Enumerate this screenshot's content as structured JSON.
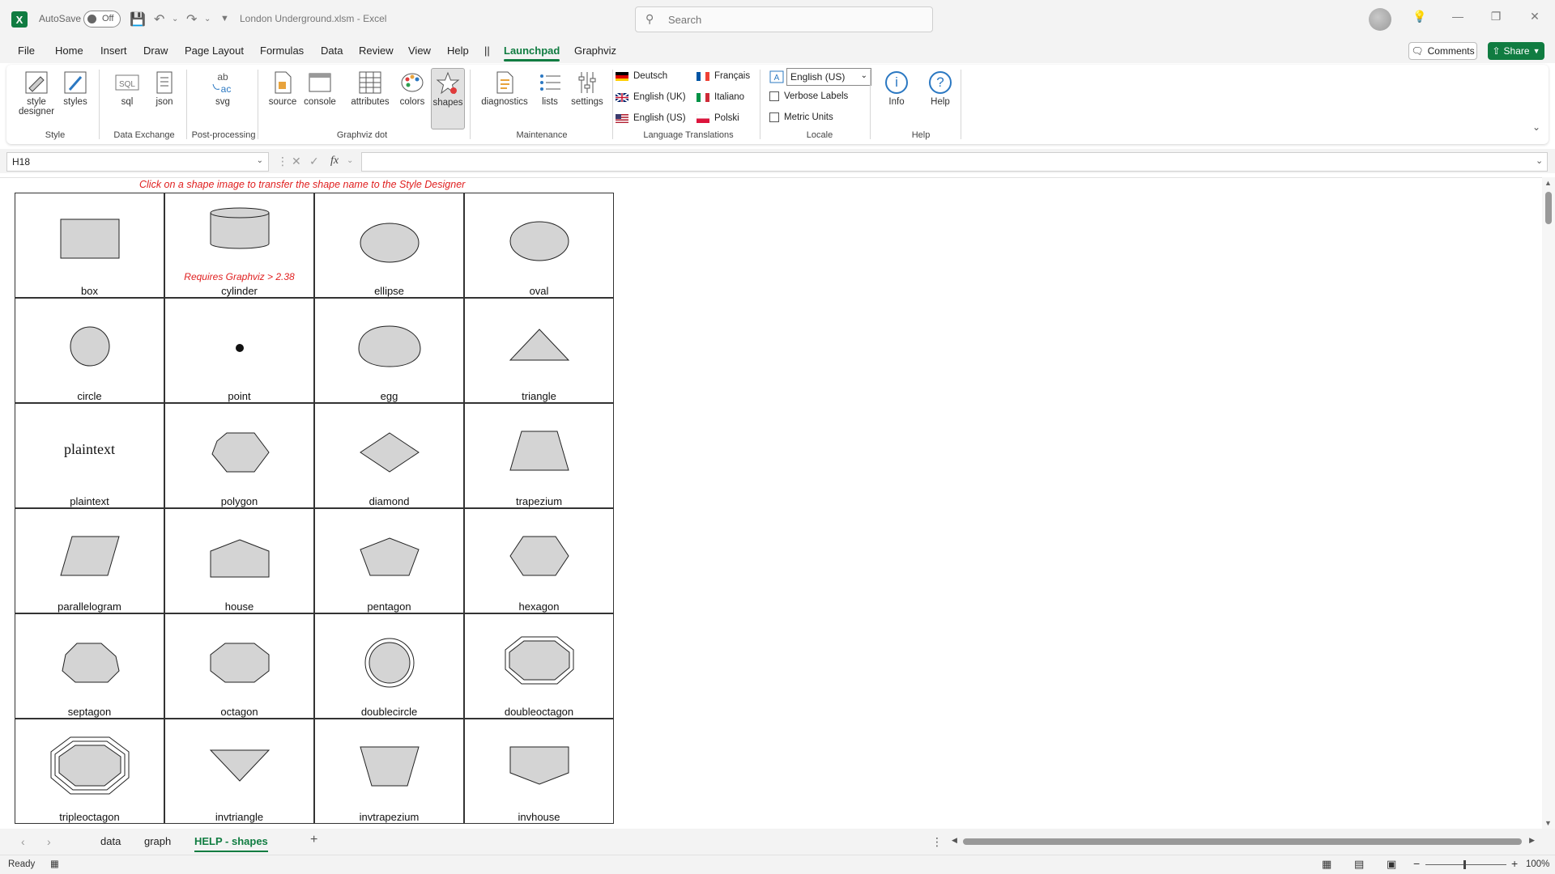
{
  "title_bar": {
    "app_icon": "excel-logo-icon",
    "autosave_label": "AutoSave",
    "autosave_state": "Off",
    "document_title": "London Underground.xlsm  -  Excel",
    "search_placeholder": "Search"
  },
  "menu": {
    "tabs": [
      "File",
      "Home",
      "Insert",
      "Draw",
      "Page Layout",
      "Formulas",
      "Data",
      "Review",
      "View",
      "Help",
      "||",
      "Launchpad",
      "Graphviz"
    ],
    "active_tab": "Launchpad",
    "comments_label": "Comments",
    "share_label": "Share"
  },
  "ribbon": {
    "groups": {
      "style": "Style",
      "data_exchange": "Data Exchange",
      "post_processing": "Post-processing",
      "graphviz_dot": "Graphviz dot",
      "maintenance": "Maintenance",
      "language_translations": "Language Translations",
      "locale": "Locale",
      "help": "Help"
    },
    "buttons": {
      "style_designer_1": "style",
      "style_designer_2": "designer",
      "styles": "styles",
      "sql": "sql",
      "json": "json",
      "svg": "svg",
      "source": "source",
      "console": "console",
      "attributes": "attributes",
      "colors": "colors",
      "shapes": "shapes",
      "diagnostics": "diagnostics",
      "lists": "lists",
      "settings": "settings",
      "info": "Info",
      "help": "Help"
    },
    "languages": {
      "deutsch": "Deutsch",
      "francais": "Français",
      "english_uk": "English (UK)",
      "italiano": "Italiano",
      "english_us": "English (US)",
      "polski": "Polski"
    },
    "locale": {
      "selected": "English (US)",
      "verbose_labels": "Verbose Labels",
      "metric_units": "Metric Units"
    }
  },
  "formula_bar": {
    "name_box": "H18",
    "fx_label": "fx",
    "formula": ""
  },
  "sheet": {
    "instruction": "Click on a shape image to transfer the shape name to the Style Designer",
    "cylinder_note": "Requires Graphviz > 2.38",
    "plaintext_sample": "plaintext",
    "shapes": [
      "box",
      "cylinder",
      "ellipse",
      "oval",
      "circle",
      "point",
      "egg",
      "triangle",
      "plaintext",
      "polygon",
      "diamond",
      "trapezium",
      "parallelogram",
      "house",
      "pentagon",
      "hexagon",
      "septagon",
      "octagon",
      "doublecircle",
      "doubleoctagon",
      "tripleoctagon",
      "invtriangle",
      "invtrapezium",
      "invhouse"
    ]
  },
  "sheet_tabs": {
    "tabs": [
      "data",
      "graph",
      "HELP - shapes"
    ],
    "active": "HELP - shapes",
    "add": "+"
  },
  "status_bar": {
    "status": "Ready",
    "zoom": "100%"
  },
  "colors": {
    "accent": "#107c41",
    "shape_fill": "#d4d4d4",
    "note_red": "#e02020"
  }
}
